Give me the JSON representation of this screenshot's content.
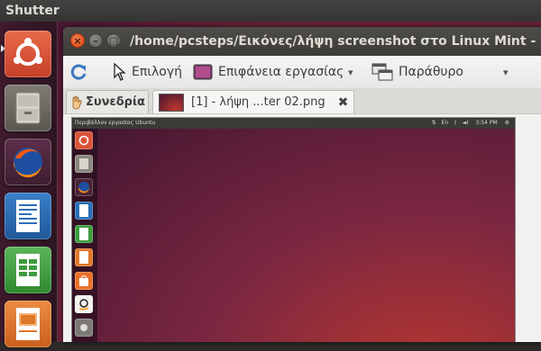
{
  "top_panel": {
    "app_name": "Shutter"
  },
  "launcher": {
    "items": [
      {
        "name": "Ubuntu Dash",
        "icon": "ubuntu-logo-icon",
        "color": "#e05a3a"
      },
      {
        "name": "Files",
        "icon": "file-cabinet-icon",
        "color": "#b9b5ad"
      },
      {
        "name": "Firefox",
        "icon": "firefox-icon",
        "color": "#e66000"
      },
      {
        "name": "LibreOffice Writer",
        "icon": "writer-document-icon",
        "color": "#2a6fb5"
      },
      {
        "name": "LibreOffice Calc",
        "icon": "calc-spreadsheet-icon",
        "color": "#3d9c3d"
      },
      {
        "name": "LibreOffice Impress",
        "icon": "impress-presentation-icon",
        "color": "#e0772a"
      }
    ]
  },
  "window": {
    "title": "/home/pcsteps/Εικόνες/λήψη screenshot στο Linux Mint - U",
    "controls": {
      "close": "×",
      "minimize": "–",
      "maximize": "□"
    }
  },
  "toolbar": {
    "refresh_icon": "refresh-icon",
    "selection_label": "Επιλογή",
    "desktop_label": "Επιφάνεια εργασίας",
    "window_label": "Παράθυρο",
    "dropdown_glyph": "▾"
  },
  "tabs": [
    {
      "label": "Συνεδρία",
      "icon": "session-hand-icon"
    },
    {
      "label": "[1] - λήψη ...ter 02.png",
      "icon": "thumbnail-icon",
      "close_glyph": "✖"
    }
  ],
  "screenshot_preview": {
    "panel_title": "Περιβάλλον εργασίας Ubuntu",
    "clock": "3:54 PM",
    "launcher_items": [
      "ubuntu",
      "files",
      "firefox",
      "writer",
      "calc",
      "impress",
      "software-center",
      "amazon",
      "settings"
    ]
  },
  "colors": {
    "accent": "#dd4814",
    "launcher_bg": "#2e1522",
    "titlebar": "#3c3b37"
  }
}
